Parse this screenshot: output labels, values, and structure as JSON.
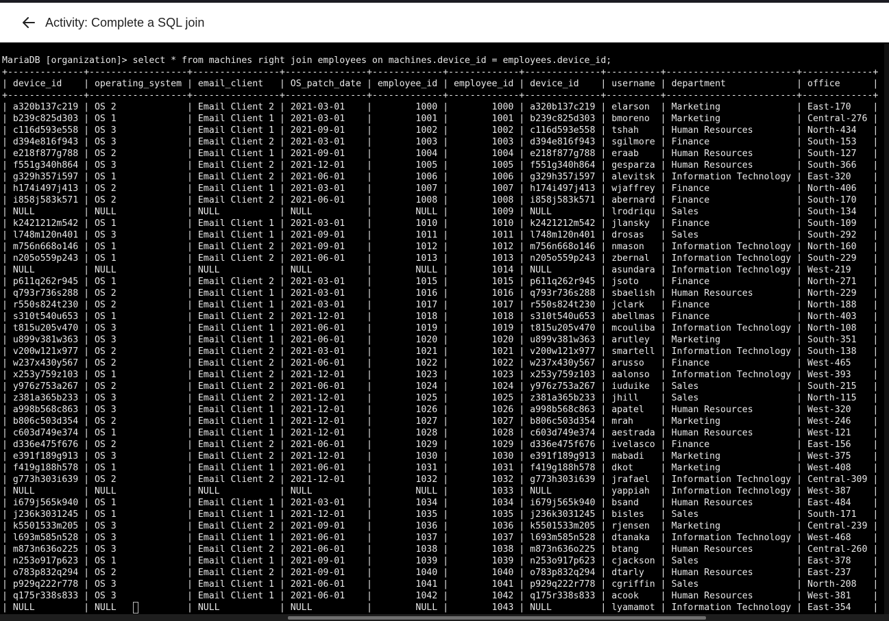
{
  "header": {
    "title": "Activity: Complete a SQL join",
    "back_icon": "arrow-left-icon"
  },
  "terminal": {
    "prompt": "MariaDB [organization]>",
    "command": "select * from machines right join employees on machines.device_id = employees.device_id;",
    "columns": [
      "device_id",
      "operating_system",
      "email_client",
      "OS_patch_date",
      "employee_id",
      "employee_id",
      "device_id",
      "username",
      "department",
      "office"
    ],
    "rows": [
      [
        "a320b137c219",
        "OS 2",
        "Email Client 2",
        "2021-03-01",
        "1000",
        "1000",
        "a320b137c219",
        "elarson",
        "Marketing",
        "East-170"
      ],
      [
        "b239c825d303",
        "OS 1",
        "Email Client 1",
        "2021-03-01",
        "1001",
        "1001",
        "b239c825d303",
        "bmoreno",
        "Marketing",
        "Central-276"
      ],
      [
        "c116d593e558",
        "OS 3",
        "Email Client 1",
        "2021-09-01",
        "1002",
        "1002",
        "c116d593e558",
        "tshah",
        "Human Resources",
        "North-434"
      ],
      [
        "d394e816f943",
        "OS 3",
        "Email Client 2",
        "2021-03-01",
        "1003",
        "1003",
        "d394e816f943",
        "sgilmore",
        "Finance",
        "South-153"
      ],
      [
        "e218f877g788",
        "OS 2",
        "Email Client 1",
        "2021-09-01",
        "1004",
        "1004",
        "e218f877g788",
        "eraab",
        "Human Resources",
        "South-127"
      ],
      [
        "f551g340h864",
        "OS 3",
        "Email Client 2",
        "2021-12-01",
        "1005",
        "1005",
        "f551g340h864",
        "gesparza",
        "Human Resources",
        "South-366"
      ],
      [
        "g329h357i597",
        "OS 1",
        "Email Client 2",
        "2021-06-01",
        "1006",
        "1006",
        "g329h357i597",
        "alevitsk",
        "Information Technology",
        "East-320"
      ],
      [
        "h174i497j413",
        "OS 2",
        "Email Client 1",
        "2021-03-01",
        "1007",
        "1007",
        "h174i497j413",
        "wjaffrey",
        "Finance",
        "North-406"
      ],
      [
        "i858j583k571",
        "OS 2",
        "Email Client 2",
        "2021-06-01",
        "1008",
        "1008",
        "i858j583k571",
        "abernard",
        "Finance",
        "South-170"
      ],
      [
        "NULL",
        "NULL",
        "NULL",
        "NULL",
        "NULL",
        "1009",
        "NULL",
        "lrodriqu",
        "Sales",
        "South-134"
      ],
      [
        "k2421212m542",
        "OS 1",
        "Email Client 1",
        "2021-03-01",
        "1010",
        "1010",
        "k2421212m542",
        "jlansky",
        "Finance",
        "South-109"
      ],
      [
        "l748m120n401",
        "OS 3",
        "Email Client 1",
        "2021-09-01",
        "1011",
        "1011",
        "l748m120n401",
        "drosas",
        "Sales",
        "South-292"
      ],
      [
        "m756n668o146",
        "OS 1",
        "Email Client 2",
        "2021-09-01",
        "1012",
        "1012",
        "m756n668o146",
        "nmason",
        "Information Technology",
        "North-160"
      ],
      [
        "n205o559p243",
        "OS 1",
        "Email Client 2",
        "2021-06-01",
        "1013",
        "1013",
        "n205o559p243",
        "zbernal",
        "Information Technology",
        "South-229"
      ],
      [
        "NULL",
        "NULL",
        "NULL",
        "NULL",
        "NULL",
        "1014",
        "NULL",
        "asundara",
        "Information Technology",
        "West-219"
      ],
      [
        "p611q262r945",
        "OS 1",
        "Email Client 2",
        "2021-03-01",
        "1015",
        "1015",
        "p611q262r945",
        "jsoto",
        "Finance",
        "North-271"
      ],
      [
        "q793r736s288",
        "OS 2",
        "Email Client 1",
        "2021-03-01",
        "1016",
        "1016",
        "q793r736s288",
        "sbaelish",
        "Human Resources",
        "North-229"
      ],
      [
        "r550s824t230",
        "OS 2",
        "Email Client 1",
        "2021-03-01",
        "1017",
        "1017",
        "r550s824t230",
        "jclark",
        "Finance",
        "North-188"
      ],
      [
        "s310t540u653",
        "OS 1",
        "Email Client 2",
        "2021-12-01",
        "1018",
        "1018",
        "s310t540u653",
        "abellmas",
        "Finance",
        "North-403"
      ],
      [
        "t815u205v470",
        "OS 3",
        "Email Client 1",
        "2021-06-01",
        "1019",
        "1019",
        "t815u205v470",
        "mcouliba",
        "Information Technology",
        "North-108"
      ],
      [
        "u899v381w363",
        "OS 3",
        "Email Client 1",
        "2021-06-01",
        "1020",
        "1020",
        "u899v381w363",
        "arutley",
        "Marketing",
        "South-351"
      ],
      [
        "v200w121x977",
        "OS 2",
        "Email Client 2",
        "2021-03-01",
        "1021",
        "1021",
        "v200w121x977",
        "smartell",
        "Information Technology",
        "South-138"
      ],
      [
        "w237x430y567",
        "OS 2",
        "Email Client 2",
        "2021-06-01",
        "1022",
        "1022",
        "w237x430y567",
        "arusso",
        "Finance",
        "West-465"
      ],
      [
        "x253y759z103",
        "OS 1",
        "Email Client 2",
        "2021-12-01",
        "1023",
        "1023",
        "x253y759z103",
        "aalonso",
        "Information Technology",
        "West-393"
      ],
      [
        "y976z753a267",
        "OS 2",
        "Email Client 2",
        "2021-06-01",
        "1024",
        "1024",
        "y976z753a267",
        "iuduike",
        "Sales",
        "South-215"
      ],
      [
        "z381a365b233",
        "OS 3",
        "Email Client 2",
        "2021-12-01",
        "1025",
        "1025",
        "z381a365b233",
        "jhill",
        "Sales",
        "North-115"
      ],
      [
        "a998b568c863",
        "OS 3",
        "Email Client 1",
        "2021-12-01",
        "1026",
        "1026",
        "a998b568c863",
        "apatel",
        "Human Resources",
        "West-320"
      ],
      [
        "b806c503d354",
        "OS 2",
        "Email Client 1",
        "2021-12-01",
        "1027",
        "1027",
        "b806c503d354",
        "mrah",
        "Marketing",
        "West-246"
      ],
      [
        "c603d749e374",
        "OS 1",
        "Email Client 1",
        "2021-12-01",
        "1028",
        "1028",
        "c603d749e374",
        "aestrada",
        "Human Resources",
        "West-121"
      ],
      [
        "d336e475f676",
        "OS 2",
        "Email Client 2",
        "2021-06-01",
        "1029",
        "1029",
        "d336e475f676",
        "ivelasco",
        "Finance",
        "East-156"
      ],
      [
        "e391f189g913",
        "OS 3",
        "Email Client 2",
        "2021-12-01",
        "1030",
        "1030",
        "e391f189g913",
        "mabadi",
        "Marketing",
        "West-375"
      ],
      [
        "f419g188h578",
        "OS 1",
        "Email Client 1",
        "2021-06-01",
        "1031",
        "1031",
        "f419g188h578",
        "dkot",
        "Marketing",
        "West-408"
      ],
      [
        "g773h303i639",
        "OS 2",
        "Email Client 2",
        "2021-12-01",
        "1032",
        "1032",
        "g773h303i639",
        "jrafael",
        "Information Technology",
        "Central-309"
      ],
      [
        "NULL",
        "NULL",
        "NULL",
        "NULL",
        "NULL",
        "1033",
        "NULL",
        "yappiah",
        "Information Technology",
        "West-387"
      ],
      [
        "i679j565k940",
        "OS 1",
        "Email Client 1",
        "2021-03-01",
        "1034",
        "1034",
        "i679j565k940",
        "bsand",
        "Human Resources",
        "East-484"
      ],
      [
        "j236k3031245",
        "OS 1",
        "Email Client 1",
        "2021-12-01",
        "1035",
        "1035",
        "j236k3031245",
        "bisles",
        "Sales",
        "South-171"
      ],
      [
        "k5501533m205",
        "OS 3",
        "Email Client 2",
        "2021-09-01",
        "1036",
        "1036",
        "k5501533m205",
        "rjensen",
        "Marketing",
        "Central-239"
      ],
      [
        "l693m585n528",
        "OS 3",
        "Email Client 1",
        "2021-06-01",
        "1037",
        "1037",
        "l693m585n528",
        "dtanaka",
        "Information Technology",
        "West-468"
      ],
      [
        "m873n636o225",
        "OS 3",
        "Email Client 2",
        "2021-06-01",
        "1038",
        "1038",
        "m873n636o225",
        "btang",
        "Human Resources",
        "Central-260"
      ],
      [
        "n253o917p623",
        "OS 1",
        "Email Client 1",
        "2021-09-01",
        "1039",
        "1039",
        "n253o917p623",
        "cjackson",
        "Sales",
        "East-378"
      ],
      [
        "o783p832q294",
        "OS 2",
        "Email Client 2",
        "2021-09-01",
        "1040",
        "1040",
        "o783p832q294",
        "dtarly",
        "Human Resources",
        "East-237"
      ],
      [
        "p929q222r778",
        "OS 3",
        "Email Client 1",
        "2021-06-01",
        "1041",
        "1041",
        "p929q222r778",
        "cgriffin",
        "Sales",
        "North-208"
      ],
      [
        "q175r338s833",
        "OS 3",
        "Email Client 1",
        "2021-06-01",
        "1042",
        "1042",
        "q175r338s833",
        "acook",
        "Human Resources",
        "West-381"
      ],
      [
        "NULL",
        "NULL",
        "NULL",
        "NULL",
        "NULL",
        "1043",
        "NULL",
        "lyamamot",
        "Information Technology",
        "East-354"
      ]
    ]
  }
}
